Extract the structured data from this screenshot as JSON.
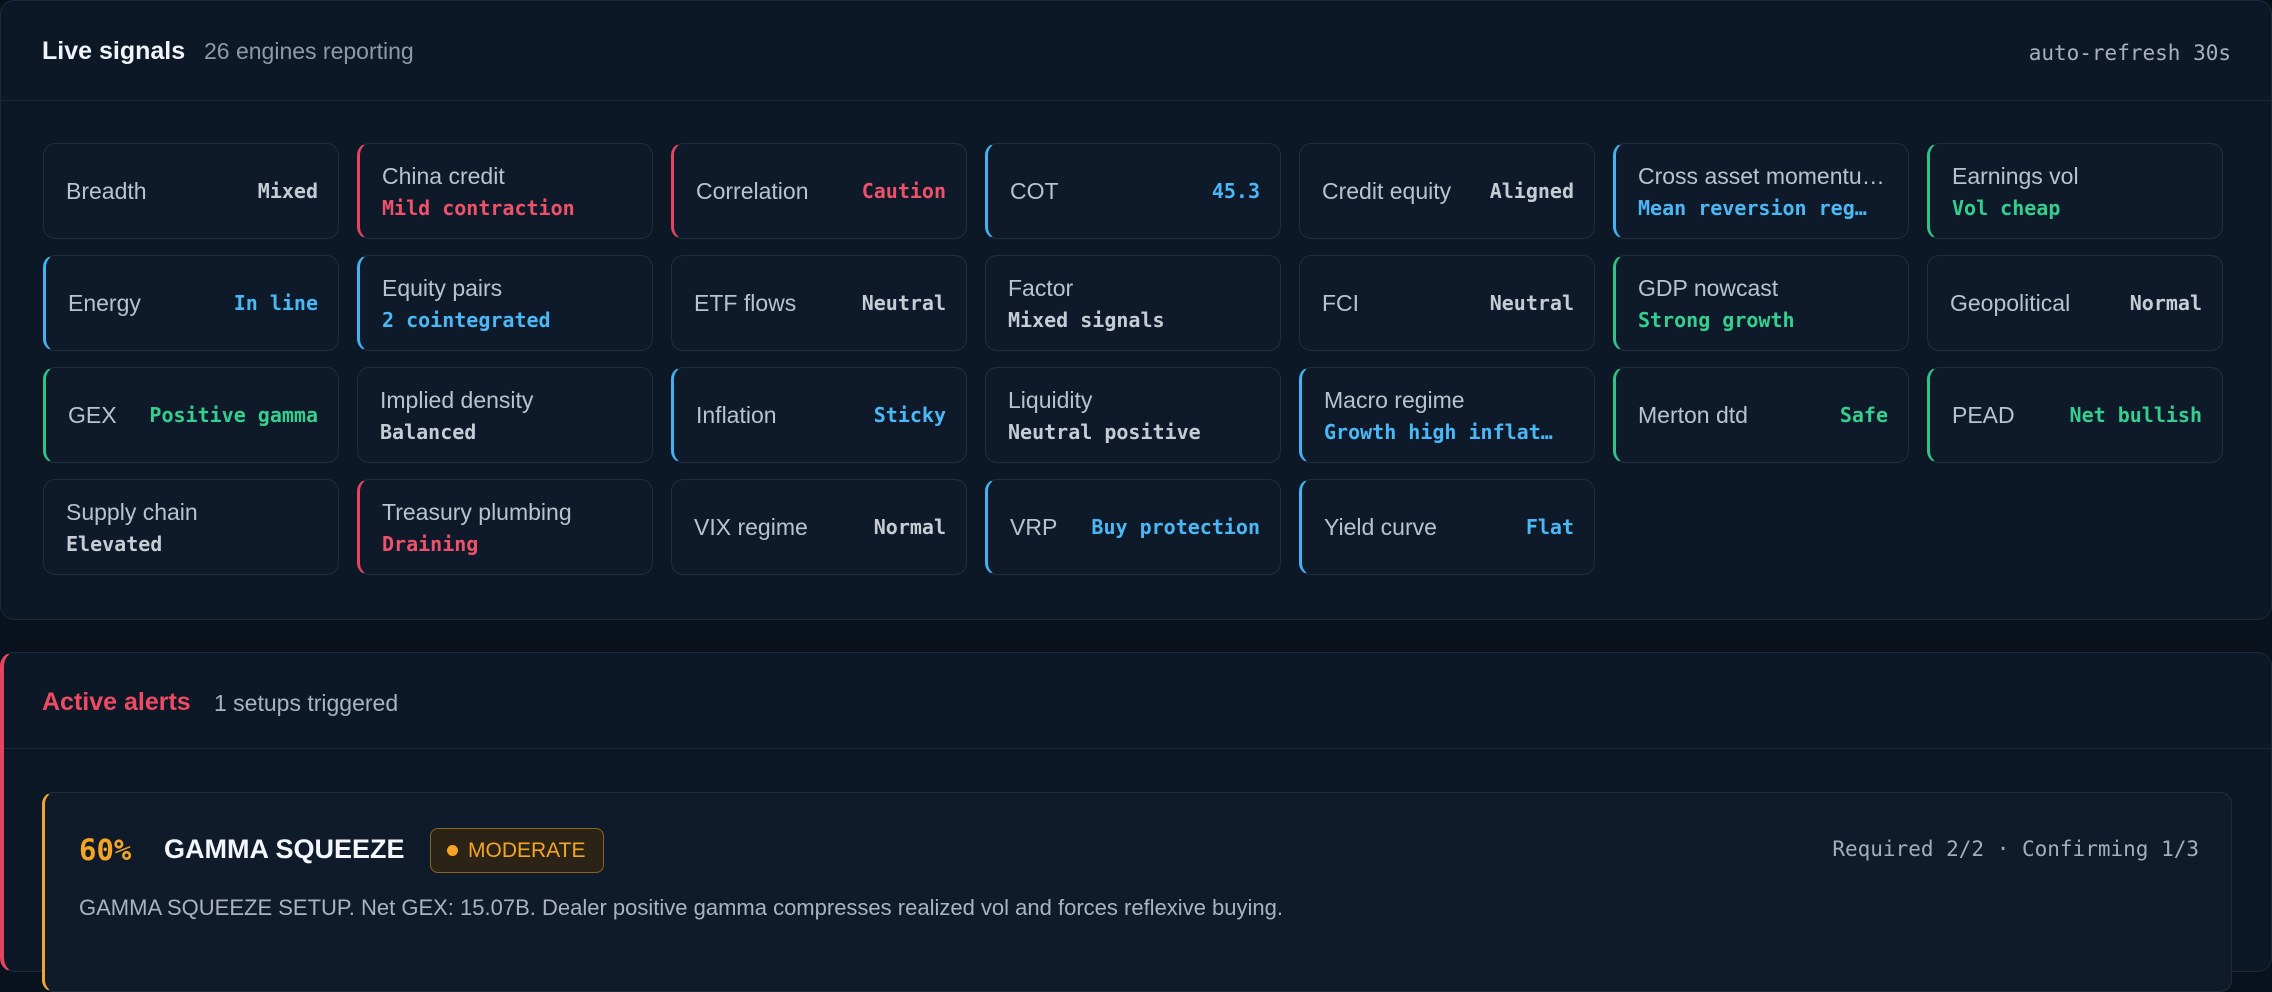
{
  "signals": {
    "title": "Live signals",
    "subtitle": "26 engines reporting",
    "refresh": "auto-refresh 30s",
    "cards": [
      {
        "label": "Breadth",
        "value": "Mixed",
        "tone": "neutral",
        "accent": "none",
        "layout": "inline"
      },
      {
        "label": "China credit",
        "value": "Mild contraction",
        "tone": "red",
        "accent": "red",
        "layout": "stack"
      },
      {
        "label": "Correlation",
        "value": "Caution",
        "tone": "red",
        "accent": "red",
        "layout": "inline"
      },
      {
        "label": "COT",
        "value": "45.3",
        "tone": "blue",
        "accent": "blue",
        "layout": "inline"
      },
      {
        "label": "Credit equity",
        "value": "Aligned",
        "tone": "neutral",
        "accent": "none",
        "layout": "inline"
      },
      {
        "label": "Cross asset momentu…",
        "value": "Mean reversion reg…",
        "tone": "blue",
        "accent": "blue",
        "layout": "stack"
      },
      {
        "label": "Earnings vol",
        "value": "Vol cheap",
        "tone": "green",
        "accent": "green",
        "layout": "stack"
      },
      {
        "label": "Energy",
        "value": "In line",
        "tone": "blue",
        "accent": "blue",
        "layout": "inline"
      },
      {
        "label": "Equity pairs",
        "value": "2 cointegrated",
        "tone": "blue",
        "accent": "blue",
        "layout": "stack"
      },
      {
        "label": "ETF flows",
        "value": "Neutral",
        "tone": "neutral",
        "accent": "none",
        "layout": "inline"
      },
      {
        "label": "Factor",
        "value": "Mixed signals",
        "tone": "neutral",
        "accent": "none",
        "layout": "stack"
      },
      {
        "label": "FCI",
        "value": "Neutral",
        "tone": "neutral",
        "accent": "none",
        "layout": "inline"
      },
      {
        "label": "GDP nowcast",
        "value": "Strong growth",
        "tone": "green",
        "accent": "green",
        "layout": "stack"
      },
      {
        "label": "Geopolitical",
        "value": "Normal",
        "tone": "neutral",
        "accent": "none",
        "layout": "inline"
      },
      {
        "label": "GEX",
        "value": "Positive gamma",
        "tone": "green",
        "accent": "green",
        "layout": "inline"
      },
      {
        "label": "Implied density",
        "value": "Balanced",
        "tone": "neutral",
        "accent": "none",
        "layout": "stack"
      },
      {
        "label": "Inflation",
        "value": "Sticky",
        "tone": "blue",
        "accent": "blue",
        "layout": "inline"
      },
      {
        "label": "Liquidity",
        "value": "Neutral positive",
        "tone": "neutral",
        "accent": "none",
        "layout": "stack"
      },
      {
        "label": "Macro regime",
        "value": "Growth high inflat…",
        "tone": "blue",
        "accent": "blue",
        "layout": "stack"
      },
      {
        "label": "Merton dtd",
        "value": "Safe",
        "tone": "green",
        "accent": "green",
        "layout": "inline"
      },
      {
        "label": "PEAD",
        "value": "Net bullish",
        "tone": "green",
        "accent": "green",
        "layout": "inline"
      },
      {
        "label": "Supply chain",
        "value": "Elevated",
        "tone": "neutral",
        "accent": "none",
        "layout": "stack"
      },
      {
        "label": "Treasury plumbing",
        "value": "Draining",
        "tone": "red",
        "accent": "red",
        "layout": "stack"
      },
      {
        "label": "VIX regime",
        "value": "Normal",
        "tone": "neutral",
        "accent": "none",
        "layout": "inline"
      },
      {
        "label": "VRP",
        "value": "Buy protection",
        "tone": "blue",
        "accent": "blue",
        "layout": "inline"
      },
      {
        "label": "Yield curve",
        "value": "Flat",
        "tone": "blue",
        "accent": "blue",
        "layout": "inline"
      }
    ]
  },
  "alerts": {
    "title": "Active alerts",
    "subtitle": "1 setups triggered",
    "items": [
      {
        "confidence": "60%",
        "name": "GAMMA SQUEEZE",
        "severity": "MODERATE",
        "meta": "Required 2/2 · Confirming 1/3",
        "description": "GAMMA SQUEEZE SETUP. Net GEX: 15.07B. Dealer positive gamma compresses realized vol and forces reflexive buying."
      }
    ]
  },
  "colors": {
    "background": "#08111c",
    "panel": "#0c1826",
    "red": "#f0516a",
    "blue": "#4bb8f6",
    "green": "#34cf8e",
    "amber": "#f5a524"
  }
}
